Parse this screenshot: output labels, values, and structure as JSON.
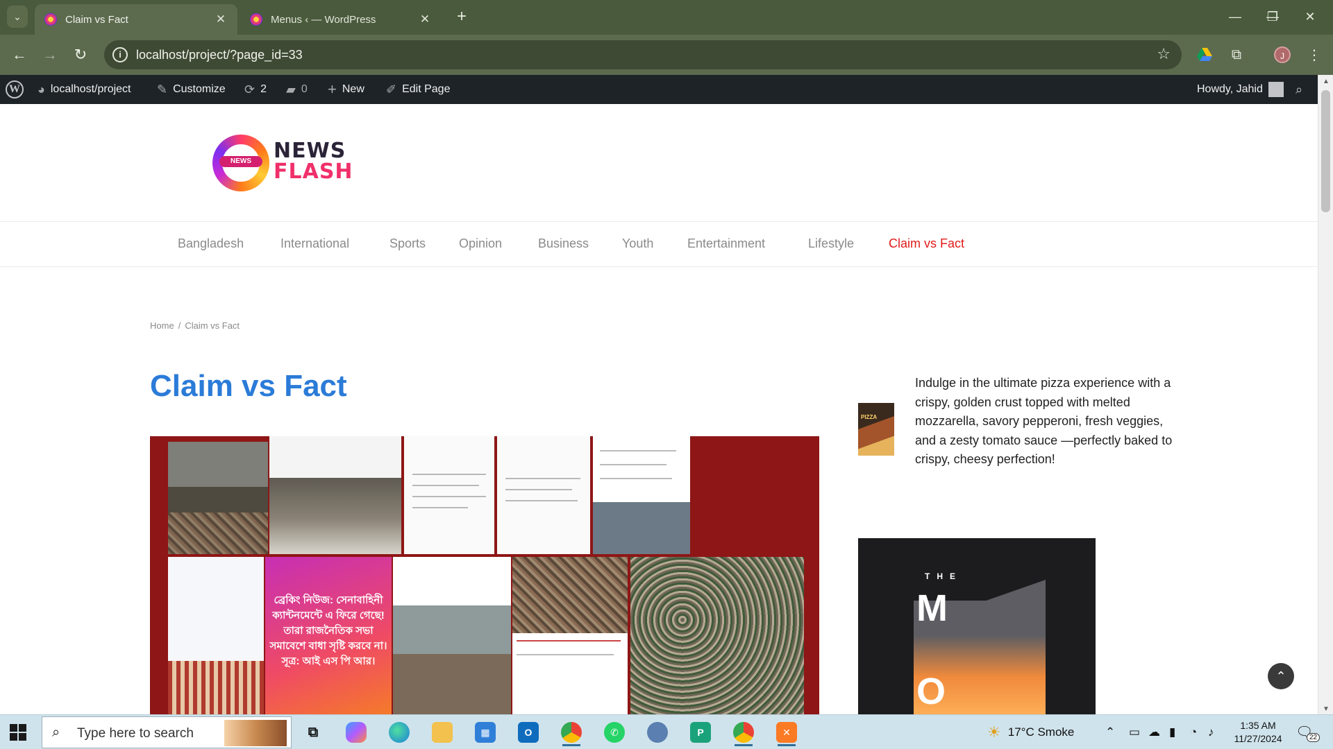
{
  "browser": {
    "tabs": [
      {
        "label": "Claim vs Fact",
        "active": true
      },
      {
        "label": "Menus ‹ — WordPress",
        "active": false
      }
    ],
    "url": "localhost/project/?page_id=33",
    "profile_initial": "J"
  },
  "adminbar": {
    "site": "localhost/project",
    "customize": "Customize",
    "updates": "2",
    "comments": "0",
    "new": "New",
    "edit": "Edit Page",
    "howdy": "Howdy, Jahid"
  },
  "site": {
    "logo": {
      "badge": "NEWS",
      "line1": "NEWS",
      "line2": "FLASH"
    },
    "menu": [
      "Bangladesh",
      "International",
      "Sports",
      "Opinion",
      "Business",
      "Youth",
      "Entertainment",
      "Lifestyle",
      "Claim vs Fact"
    ],
    "current_menu": "Claim vs Fact",
    "breadcrumb": {
      "home": "Home",
      "sep": "/",
      "current": "Claim vs Fact"
    },
    "title": "Claim vs Fact",
    "sidebar": {
      "ad_text": "Indulge in the ultimate pizza experience with a crispy, golden crust topped with melted mozzarella, savory pepperoni, fresh veggies, and a zesty tomato sauce —perfectly baked to crispy, cheesy perfection!",
      "ad_thumb_label": "PIZZA",
      "promo_the": "THE",
      "promo_letters": [
        "M",
        "O"
      ]
    }
  },
  "collage_text": {
    "panel_1": "ব্রেকিং নিউজ: সেনাবাহিনী ক্যান্টনমেন্টে এ ফিরে গেছে! তারা রাজনৈতিক সভা সমাবেশে বাধা সৃষ্টি করবে না। সূত্র: আই এস পি আর।"
  },
  "taskbar": {
    "search_placeholder": "Type here to search",
    "weather": "17°C  Smoke",
    "time": "1:35 AM",
    "date": "11/27/2024",
    "notifications": "22"
  },
  "colors": {
    "accent_link": "#2b7bd8",
    "menu_current": "#e01b1b",
    "adminbar": "#1d2327",
    "chrome": "#5c6a4e"
  }
}
